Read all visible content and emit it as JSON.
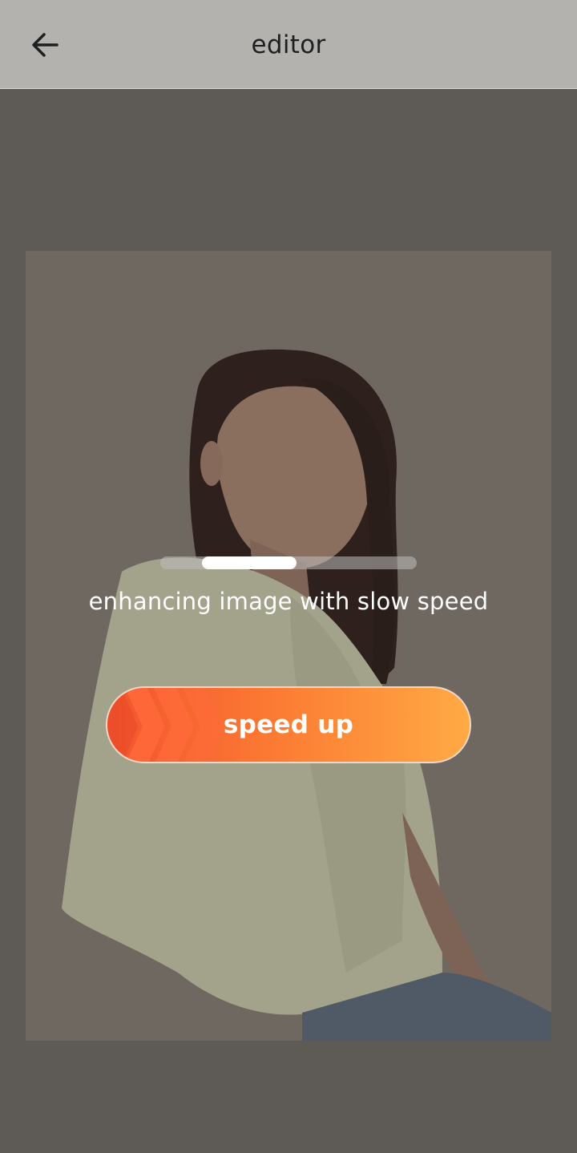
{
  "header": {
    "title": "editor",
    "back_icon": "arrow-left-icon"
  },
  "photo": {
    "icon": "portrait-photo"
  },
  "progress": {
    "value": 0.37,
    "status_text": "enhancing image with slow speed"
  },
  "cta": {
    "label": "speed up",
    "icon": "chevrons-right-icon"
  },
  "colors": {
    "header_bg": "#b3b2ae",
    "overlay_bg": "#5e5b57",
    "button_start": "#f2542d",
    "button_end": "#ffaa44"
  }
}
